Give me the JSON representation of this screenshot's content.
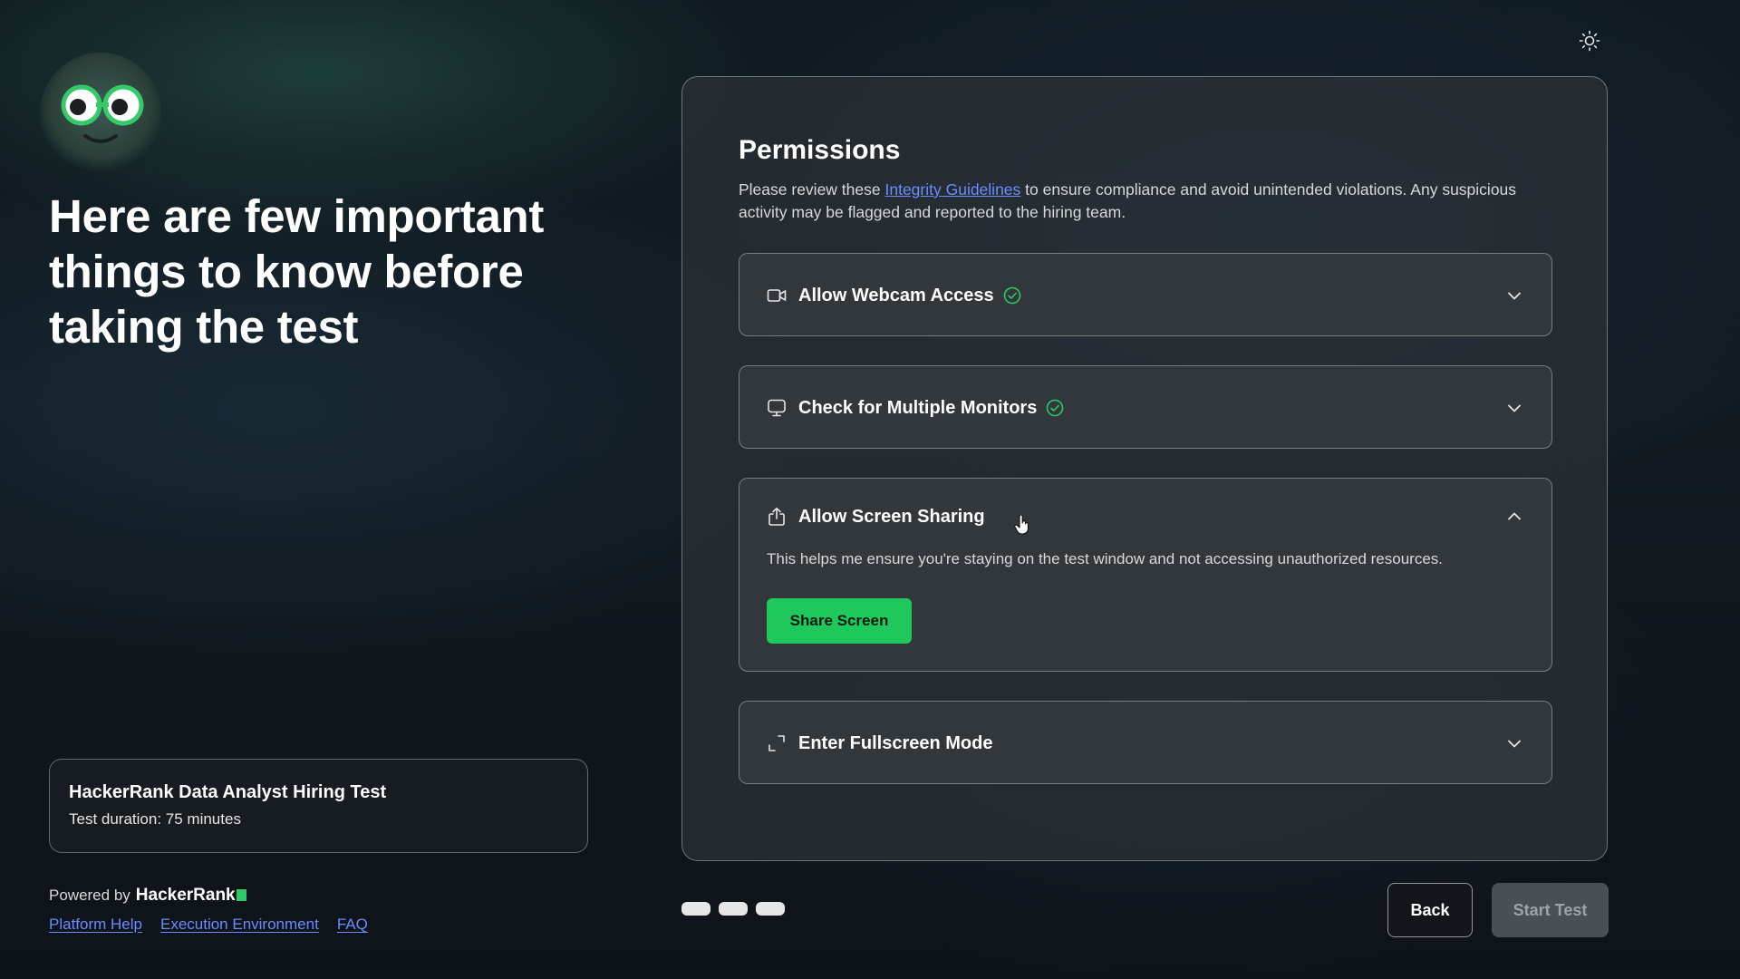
{
  "intro": {
    "headline": "Here are few important things to know before taking the test"
  },
  "test": {
    "name": "HackerRank Data Analyst Hiring Test",
    "duration": "Test duration: 75 minutes"
  },
  "footer": {
    "powered_by": "Powered by",
    "brand": "HackerRank",
    "links": [
      "Platform Help",
      "Execution Environment",
      "FAQ"
    ]
  },
  "permissions": {
    "title": "Permissions",
    "desc_before": "Please review these ",
    "desc_link": "Integrity Guidelines",
    "desc_after": " to ensure compliance and avoid unintended violations. Any suspicious activity may be flagged and reported to the hiring team.",
    "items": [
      {
        "title": "Allow Webcam Access",
        "icon": "webcam-icon",
        "status": "granted",
        "expanded": false
      },
      {
        "title": "Check for Multiple Monitors",
        "icon": "monitor-icon",
        "status": "granted",
        "expanded": false
      },
      {
        "title": "Allow Screen Sharing",
        "icon": "share-icon",
        "status": "pending",
        "expanded": true,
        "description": "This helps me ensure you're staying on the test window and not accessing unauthorized resources.",
        "button": "Share Screen"
      },
      {
        "title": "Enter Fullscreen Mode",
        "icon": "fullscreen-icon",
        "status": "pending",
        "expanded": false
      }
    ]
  },
  "nav": {
    "back": "Back",
    "start": "Start Test"
  },
  "colors": {
    "accent_green": "#1fc85a",
    "link_blue": "#6b8cff",
    "check_green": "#2ec866"
  }
}
